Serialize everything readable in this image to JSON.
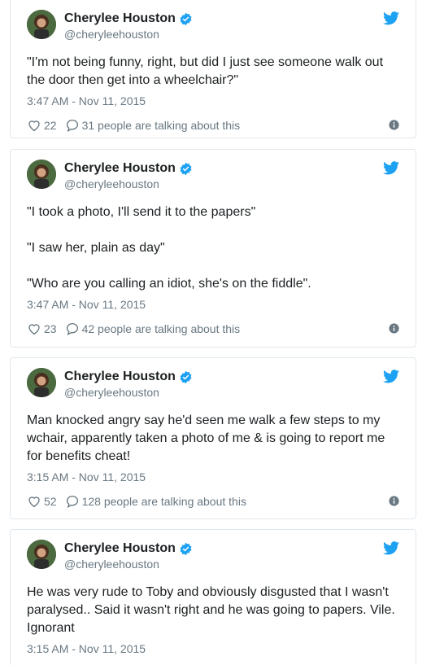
{
  "colors": {
    "twitter_blue": "#1da1f2",
    "muted": "#697882",
    "text": "#1c2022",
    "border": "#e1e8ed"
  },
  "tweets": [
    {
      "name": "Cherylee Houston",
      "handle": "@cheryleehouston",
      "text": "\"I'm not being funny, right, but did I just see someone walk out the door then get into a wheelchair?\"",
      "time": "3:47 AM - Nov 11, 2015",
      "likes": "22",
      "talking": "31 people are talking about this"
    },
    {
      "name": "Cherylee Houston",
      "handle": "@cheryleehouston",
      "text": "\"I took a photo, I'll send it to the papers\"\n\n\"I saw her, plain as day\"\n\n\"Who are you calling an idiot, she's on the fiddle\".",
      "time": "3:47 AM - Nov 11, 2015",
      "likes": "23",
      "talking": "42 people are talking about this"
    },
    {
      "name": "Cherylee Houston",
      "handle": "@cheryleehouston",
      "text": "Man knocked angry say he'd seen me walk a few steps to my wchair, apparently taken a photo of me & is going to report me for benefits cheat!",
      "time": "3:15 AM - Nov 11, 2015",
      "likes": "52",
      "talking": "128 people are talking about this"
    },
    {
      "name": "Cherylee Houston",
      "handle": "@cheryleehouston",
      "text": "He was very rude to Toby and obviously disgusted that I wasn't paralysed.. Said it wasn't right and he was going to papers. Vile. Ignorant",
      "time": "3:15 AM - Nov 11, 2015"
    }
  ]
}
